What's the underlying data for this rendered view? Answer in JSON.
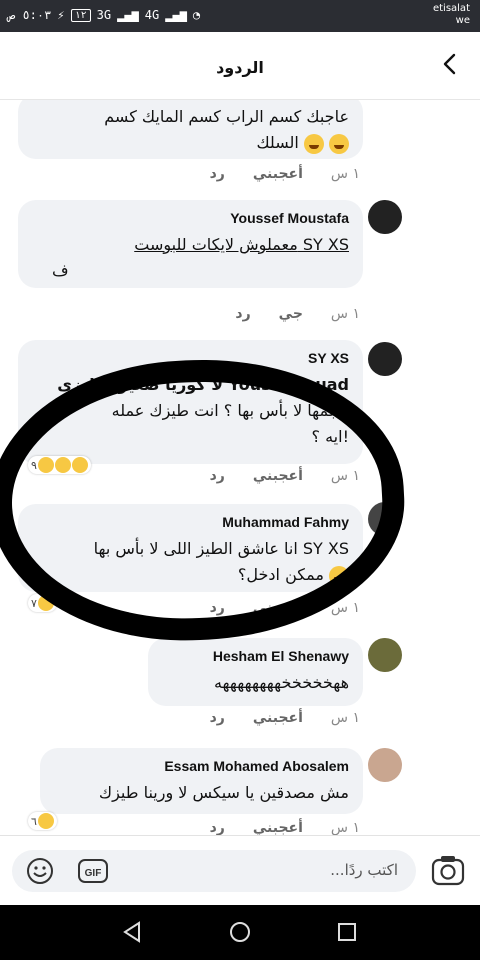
{
  "status": {
    "time": "٥:٠٣ ص",
    "battery": "١٢",
    "net1": "3G",
    "net2": "4G",
    "carrier_line1": "etisalat",
    "carrier_line2": "we"
  },
  "header": {
    "title": "الردود"
  },
  "comments": [
    {
      "text_line1": "عاجبك كسم الراب كسم المايك كسم",
      "text_line2": "السلك",
      "time": "١ س",
      "like": "أعجبني",
      "reply": "رد"
    },
    {
      "name": "Youssef Moustafa",
      "text_line1": "معملوش لايكات للبوست SY XS",
      "text_line2": "ف",
      "time": "١ س",
      "like": "جي",
      "reply": "رد"
    },
    {
      "name": "SY XS",
      "text_line1": "لا كوريا صغيره طيزى Yousef Fouad",
      "text_line2": "حجمها لا بأس بها ؟ انت طيزك عمله",
      "text_line3": "ايه ؟!",
      "time": "١ س",
      "like": "أعجبني",
      "reply": "رد",
      "reaction_count": "٩"
    },
    {
      "name": "Muhammad Fahmy",
      "text_line1": "انا عاشق الطيز اللى لا بأس بها SY XS",
      "text_line2": "ممكن ادخل؟",
      "time": "١ س",
      "like": "أعجبني",
      "reply": "رد",
      "reaction_count": "٧"
    },
    {
      "name": "Hesham El Shenawy",
      "text_line1": "ههخخخخخههههههههه",
      "time": "١ س",
      "like": "أعجبني",
      "reply": "رد"
    },
    {
      "name": "Essam Mohamed Abosalem",
      "text_line1": "مش مصدقين يا سيكس لا ورينا طيزك",
      "time": "١ س",
      "like": "أعجبني",
      "reply": "رد",
      "reaction_count": "٦"
    }
  ],
  "input": {
    "placeholder": "اكتب ردًا...",
    "gif_label": "GIF"
  },
  "icons": {
    "back": "chevron-left-icon",
    "camera": "camera-icon",
    "emoji": "smiley-icon",
    "nav_back": "triangle-back-icon",
    "nav_home": "circle-home-icon",
    "nav_recent": "square-recent-icon"
  }
}
